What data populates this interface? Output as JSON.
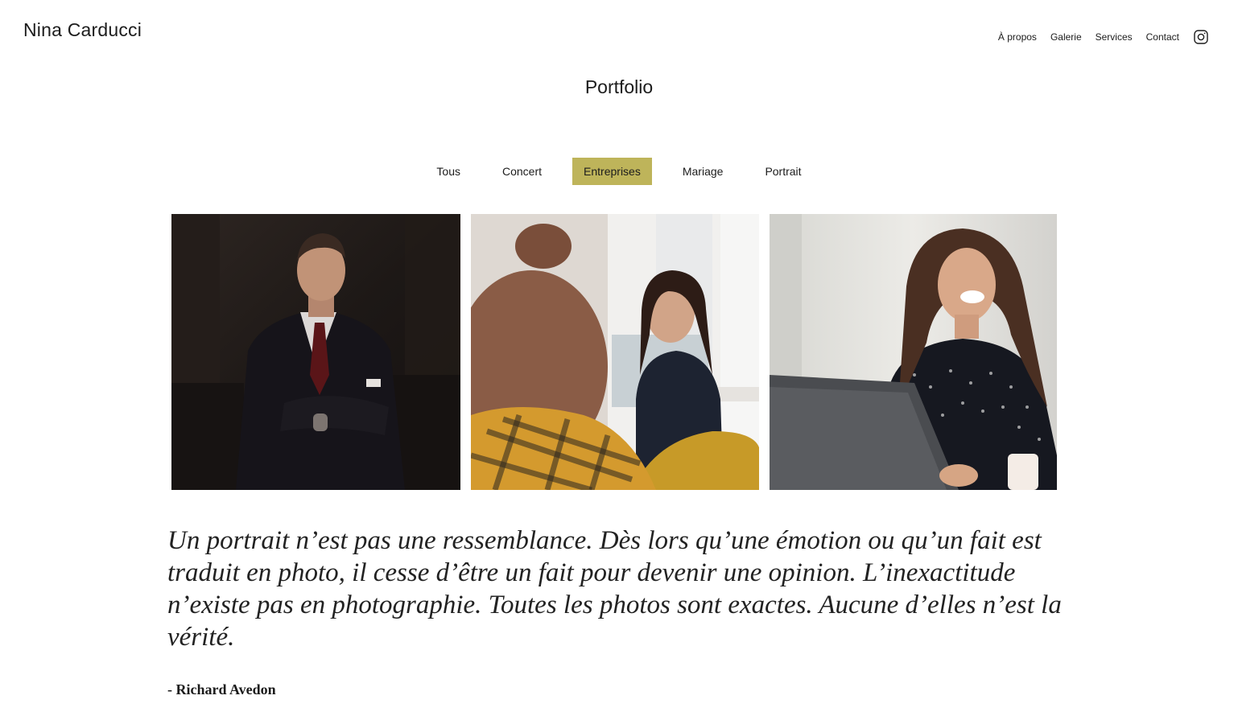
{
  "header": {
    "brand": "Nina Carducci",
    "nav": [
      {
        "label": "À propos"
      },
      {
        "label": "Galerie"
      },
      {
        "label": "Services"
      },
      {
        "label": "Contact"
      }
    ],
    "social_icon": "instagram-icon"
  },
  "portfolio": {
    "title": "Portfolio",
    "filters": [
      {
        "label": "Tous",
        "active": false
      },
      {
        "label": "Concert",
        "active": false
      },
      {
        "label": "Entreprises",
        "active": true
      },
      {
        "label": "Mariage",
        "active": false
      },
      {
        "label": "Portrait",
        "active": false
      }
    ],
    "active_color": "#beb45a"
  },
  "testimonial": {
    "quote": "Un portrait n’est pas une ressemblance. Dès lors qu’une émotion ou qu’un fait est traduit en photo, il cesse d’être un fait pour devenir une opinion. L’inexactitude n’existe pas en photographie. Toutes les photos sont exactes. Aucune d’elles n’est la vérité.",
    "author": "- Richard Avedon"
  }
}
